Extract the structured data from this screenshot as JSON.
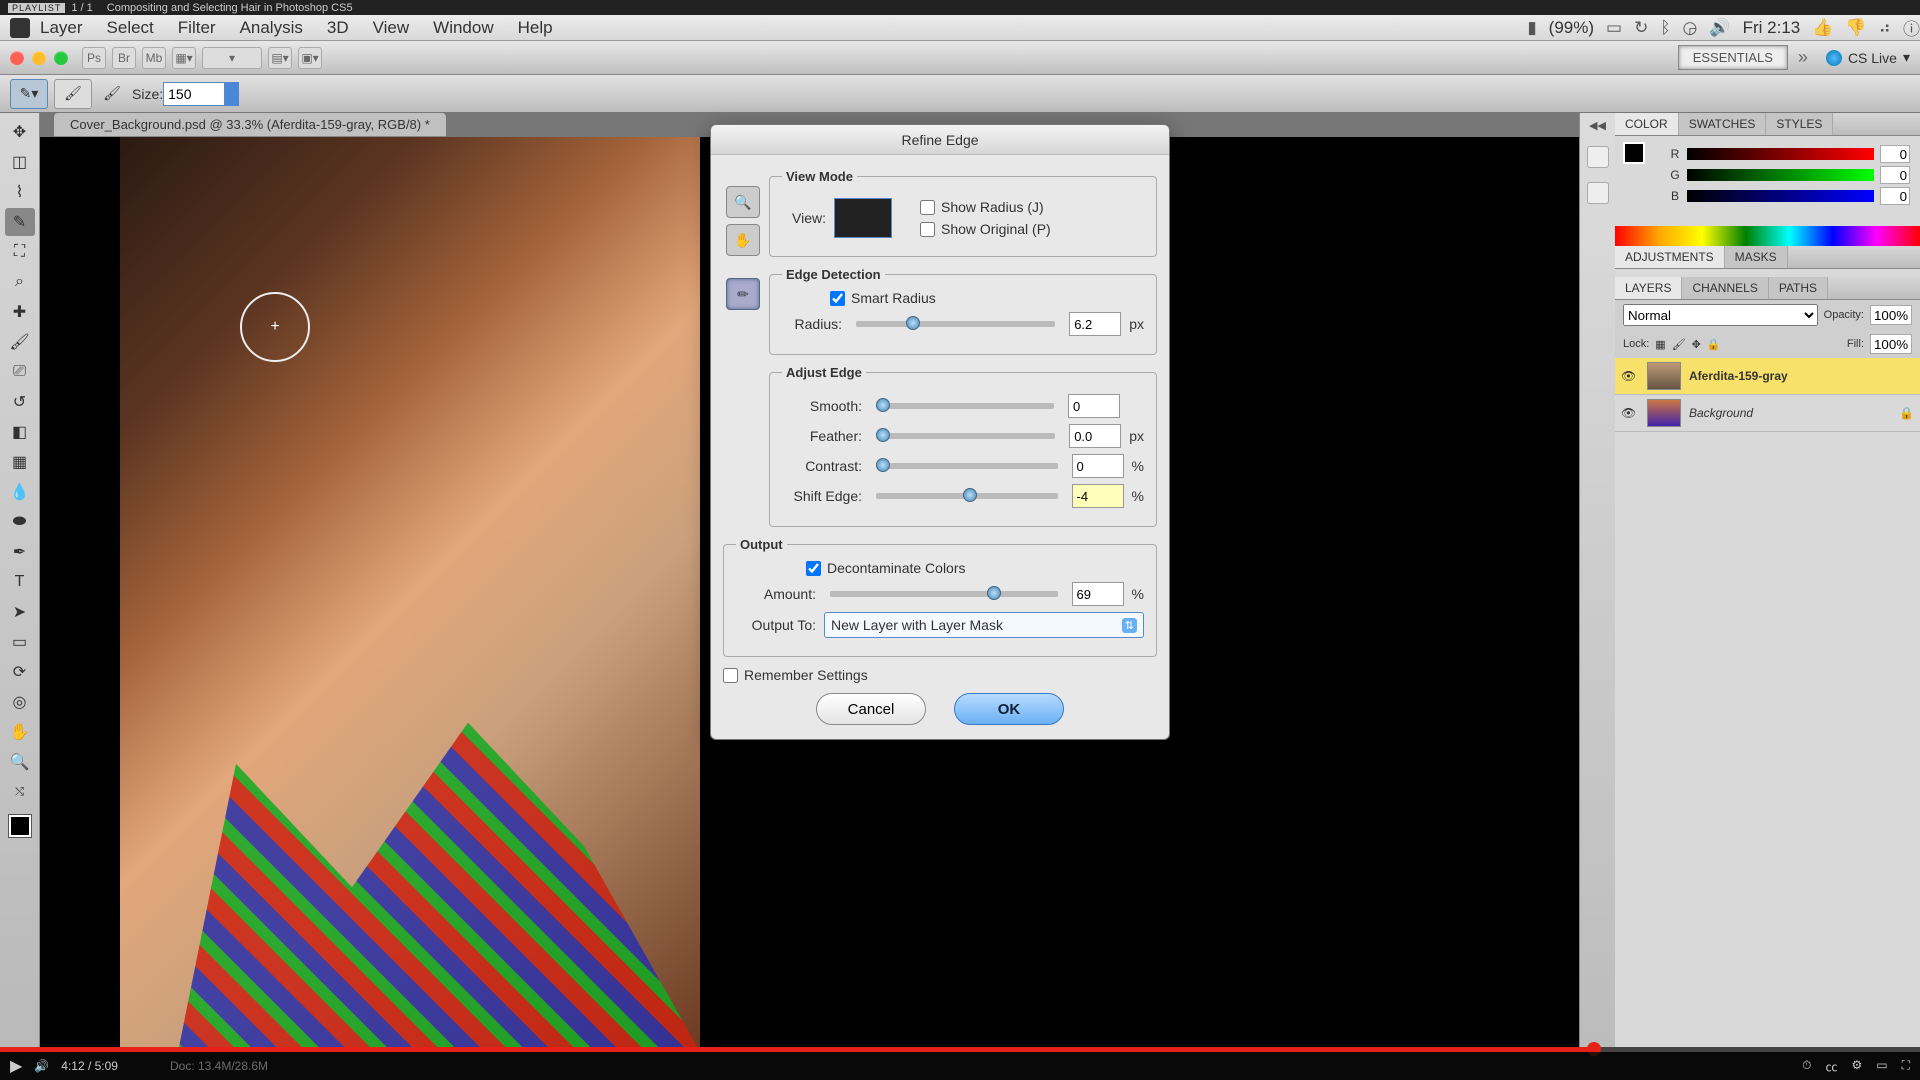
{
  "playlist": {
    "tag": "PLAYLIST",
    "index": "1 / 1",
    "title": "Compositing and Selecting Hair in Photoshop CS5"
  },
  "menubar": {
    "items": [
      "Layer",
      "Select",
      "Filter",
      "Analysis",
      "3D",
      "View",
      "Window",
      "Help"
    ],
    "battery": "(99%)",
    "clock": "Fri 2:13"
  },
  "appbar": {
    "workspaces": [
      "ESSENTIALS"
    ],
    "cslive": "CS Live"
  },
  "optbar": {
    "size_label": "Size:",
    "size_value": "150"
  },
  "doc_tab": "Cover_Background.psd @ 33.3% (Aferdita-159-gray, RGB/8) *",
  "dialog": {
    "title": "Refine Edge",
    "view_mode": {
      "legend": "View Mode",
      "view_label": "View:",
      "show_radius": "Show Radius (J)",
      "show_original": "Show Original (P)"
    },
    "edge_detection": {
      "legend": "Edge Detection",
      "smart_radius": "Smart Radius",
      "smart_radius_checked": true,
      "radius_label": "Radius:",
      "radius_value": "6.2",
      "radius_unit": "px",
      "radius_pct": 25
    },
    "adjust_edge": {
      "legend": "Adjust Edge",
      "smooth_label": "Smooth:",
      "smooth_value": "0",
      "smooth_pct": 0,
      "feather_label": "Feather:",
      "feather_value": "0.0",
      "feather_unit": "px",
      "feather_pct": 0,
      "contrast_label": "Contrast:",
      "contrast_value": "0",
      "contrast_unit": "%",
      "contrast_pct": 0,
      "shift_label": "Shift Edge:",
      "shift_value": "-4",
      "shift_unit": "%",
      "shift_pct": 48
    },
    "output": {
      "legend": "Output",
      "decon": "Decontaminate Colors",
      "decon_checked": true,
      "amount_label": "Amount:",
      "amount_value": "69",
      "amount_unit": "%",
      "amount_pct": 69,
      "outputto_label": "Output To:",
      "outputto_value": "New Layer with Layer Mask"
    },
    "remember": "Remember Settings",
    "cancel": "Cancel",
    "ok": "OK"
  },
  "panels": {
    "color_tabs": [
      "COLOR",
      "SWATCHES",
      "STYLES"
    ],
    "color": {
      "r_label": "R",
      "g_label": "G",
      "b_label": "B",
      "r": "0",
      "g": "0",
      "b": "0"
    },
    "adj_tabs": [
      "ADJUSTMENTS",
      "MASKS"
    ],
    "layer_tabs": [
      "LAYERS",
      "CHANNELS",
      "PATHS"
    ],
    "blend_mode": "Normal",
    "opacity_label": "Opacity:",
    "opacity": "100%",
    "lock_label": "Lock:",
    "fill_label": "Fill:",
    "fill": "100%",
    "layers": [
      {
        "name": "Aferdita-159-gray",
        "selected": true
      },
      {
        "name": "Background",
        "selected": false,
        "locked": true
      }
    ]
  },
  "video": {
    "time": "4:12 / 5:09",
    "progress_pct": 83
  },
  "statusbar": {
    "doc": "Doc: 13.4M/28.6M"
  }
}
